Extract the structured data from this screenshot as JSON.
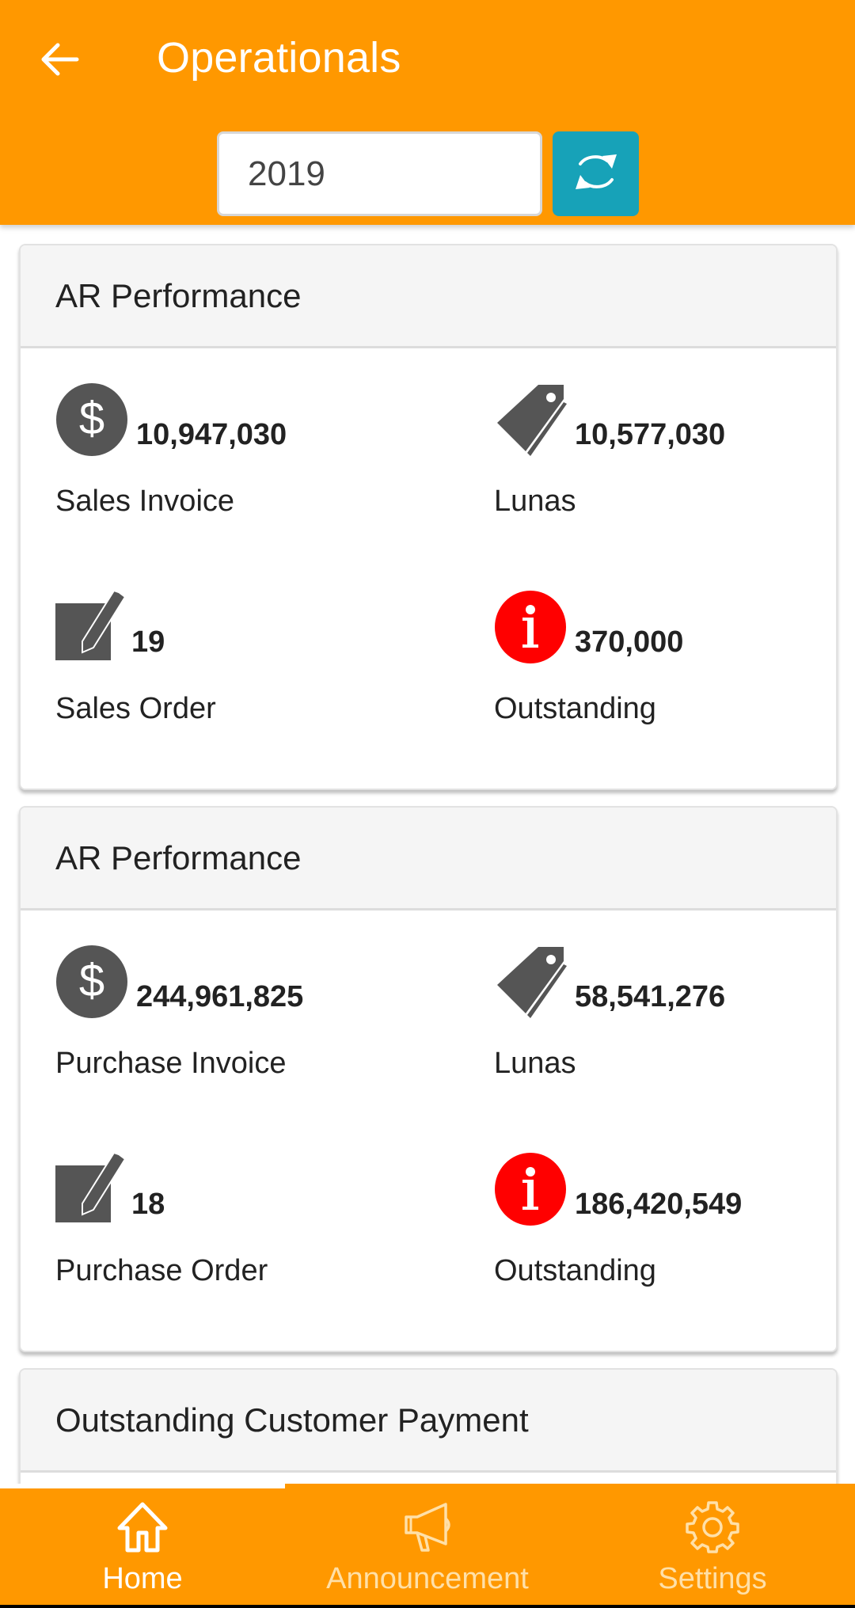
{
  "header": {
    "title": "Operationals",
    "back_icon": "arrow-left-icon",
    "year_input_value": "2019",
    "refresh_icon": "refresh-icon"
  },
  "colors": {
    "primary": "#FF9800",
    "refresh_button": "#17A2B8",
    "icon_gray": "#555555",
    "alert_red": "#FF0000",
    "card_header_bg": "#F5F5F5"
  },
  "cards": [
    {
      "title": "AR Performance",
      "metrics": [
        {
          "icon": "dollar-icon",
          "value": "10,947,030",
          "label": "Sales Invoice"
        },
        {
          "icon": "tag-icon",
          "value": "10,577,030",
          "label": "Lunas"
        },
        {
          "icon": "edit-icon",
          "value": "19",
          "label": "Sales Order"
        },
        {
          "icon": "info-icon",
          "value": "370,000",
          "label": "Outstanding"
        }
      ]
    },
    {
      "title": "AR Performance",
      "metrics": [
        {
          "icon": "dollar-icon",
          "value": "244,961,825",
          "label": "Purchase Invoice"
        },
        {
          "icon": "tag-icon",
          "value": "58,541,276",
          "label": "Lunas"
        },
        {
          "icon": "edit-icon",
          "value": "18",
          "label": "Purchase Order"
        },
        {
          "icon": "info-icon",
          "value": "186,420,549",
          "label": "Outstanding"
        }
      ]
    },
    {
      "title": "Outstanding Customer Payment"
    }
  ],
  "bottom_nav": {
    "items": [
      {
        "label": "Home",
        "icon": "home-icon",
        "active": true
      },
      {
        "label": "Announcement",
        "icon": "megaphone-icon",
        "active": false
      },
      {
        "label": "Settings",
        "icon": "gear-icon",
        "active": false
      }
    ]
  }
}
